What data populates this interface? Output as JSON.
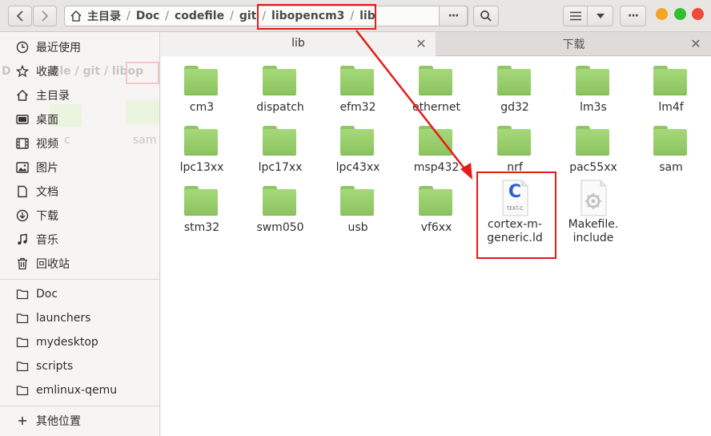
{
  "pathbar": {
    "crumbs": [
      "主目录",
      "Doc",
      "codefile",
      "git",
      "libopencm3",
      "lib"
    ],
    "menu_label": "···"
  },
  "toolbar": {
    "more_label": "···"
  },
  "window_controls": {
    "minimize_color": "#f5a623",
    "maximize_color": "#2fbf2f",
    "close_color": "#ef4a3a"
  },
  "sidebar": {
    "places": [
      {
        "label": "最近使用",
        "icon": "clock-icon"
      },
      {
        "label": "收藏",
        "icon": "star-icon"
      },
      {
        "label": "主目录",
        "icon": "home-icon"
      },
      {
        "label": "桌面",
        "icon": "desktop-icon"
      },
      {
        "label": "视频",
        "icon": "video-icon"
      },
      {
        "label": "图片",
        "icon": "image-icon"
      },
      {
        "label": "文档",
        "icon": "document-icon"
      },
      {
        "label": "下载",
        "icon": "download-icon"
      },
      {
        "label": "音乐",
        "icon": "music-icon"
      },
      {
        "label": "回收站",
        "icon": "trash-icon"
      }
    ],
    "bookmarks": [
      {
        "label": "Doc",
        "icon": "folder-icon"
      },
      {
        "label": "launchers",
        "icon": "folder-icon"
      },
      {
        "label": "mydesktop",
        "icon": "folder-icon"
      },
      {
        "label": "scripts",
        "icon": "folder-icon"
      },
      {
        "label": "emlinux-qemu",
        "icon": "folder-icon"
      }
    ],
    "other": {
      "label": "其他位置",
      "icon": "plus-icon"
    },
    "ghost": {
      "left": "D",
      "mid": "file / git / libop",
      "cell1": "c",
      "cell2": "sam"
    }
  },
  "tabs": [
    {
      "label": "lib",
      "active": true
    },
    {
      "label": "下载",
      "active": false
    }
  ],
  "close_glyph": "✕",
  "files": [
    {
      "label": "cm3",
      "type": "folder"
    },
    {
      "label": "dispatch",
      "type": "folder"
    },
    {
      "label": "efm32",
      "type": "folder"
    },
    {
      "label": "ethernet",
      "type": "folder"
    },
    {
      "label": "gd32",
      "type": "folder"
    },
    {
      "label": "lm3s",
      "type": "folder"
    },
    {
      "label": "lm4f",
      "type": "folder"
    },
    {
      "label": "lpc13xx",
      "type": "folder"
    },
    {
      "label": "lpc17xx",
      "type": "folder"
    },
    {
      "label": "lpc43xx",
      "type": "folder"
    },
    {
      "label": "msp432",
      "type": "folder"
    },
    {
      "label": "nrf",
      "type": "folder"
    },
    {
      "label": "pac55xx",
      "type": "folder"
    },
    {
      "label": "sam",
      "type": "folder"
    },
    {
      "label": "stm32",
      "type": "folder"
    },
    {
      "label": "swm050",
      "type": "folder"
    },
    {
      "label": "usb",
      "type": "folder"
    },
    {
      "label": "vf6xx",
      "type": "folder"
    },
    {
      "label": "cortex-m-generic.ld",
      "label_lines": [
        "cortex-m-",
        "generic.ld"
      ],
      "type": "text-c",
      "glyph": "C",
      "badge": "TEXT-C"
    },
    {
      "label": "Makefile.include",
      "label_lines": [
        "Makefile.",
        "include"
      ],
      "type": "makefile"
    }
  ],
  "colors": {
    "annotation": "#e41b17",
    "folder": "#8cc45f",
    "c_file": "#2f5fd0"
  }
}
